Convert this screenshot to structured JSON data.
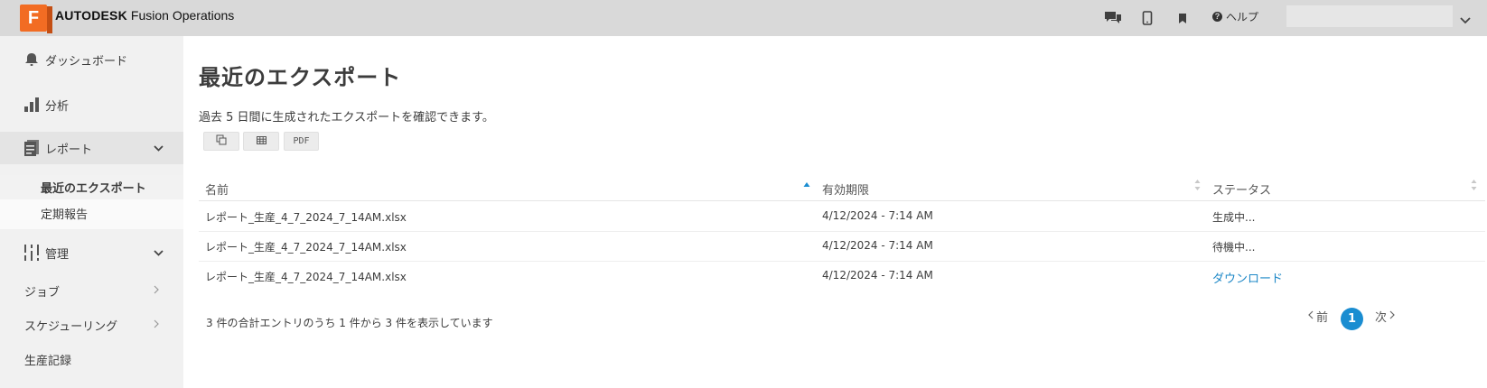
{
  "app": {
    "logo_letter": "F",
    "brand_bold": "AUTODESK",
    "brand_product": "Fusion Operations",
    "help_label": "ヘルプ"
  },
  "sidebar": {
    "items": [
      {
        "label": "ダッシュボード",
        "icon": "bell-icon"
      },
      {
        "label": "分析",
        "icon": "bar-chart-icon"
      },
      {
        "label": "レポート",
        "icon": "report-icon"
      },
      {
        "label": "管理",
        "icon": "admin-icon"
      },
      {
        "label": "ジョブ"
      },
      {
        "label": "スケジューリング"
      },
      {
        "label": "生産記録"
      }
    ],
    "report_sub": [
      {
        "label": "最近のエクスポート"
      },
      {
        "label": "定期報告"
      }
    ]
  },
  "main": {
    "title": "最近のエクスポート",
    "description": "過去 5 日間に生成されたエクスポートを確認できます。",
    "export_buttons": [
      {
        "label": "",
        "icon": "copy-icon"
      },
      {
        "label": "",
        "icon": "table-icon"
      },
      {
        "label": "PDF"
      }
    ],
    "columns": [
      "名前",
      "有効期限",
      "ステータス"
    ],
    "rows": [
      {
        "name": "レポート_生産_4_7_2024_7_14AM.xlsx",
        "expires": "4/12/2024 - 7:14 AM",
        "status": "生成中..."
      },
      {
        "name": "レポート_生産_4_7_2024_7_14AM.xlsx",
        "expires": "4/12/2024 - 7:14 AM",
        "status": "待機中..."
      },
      {
        "name": "レポート_生産_4_7_2024_7_14AM.xlsx",
        "expires": "4/12/2024 - 7:14 AM",
        "status": "ダウンロード"
      }
    ],
    "footer": "3 件の合計エントリのうち 1 件から 3  件を表示しています",
    "pagination": {
      "prev": "前",
      "current": "1",
      "next": "次"
    }
  },
  "colors": {
    "accent": "#1a8dd1",
    "logo": "#f26c23",
    "topbar": "#d9d9d9",
    "sidebar": "#f1f1f1"
  }
}
